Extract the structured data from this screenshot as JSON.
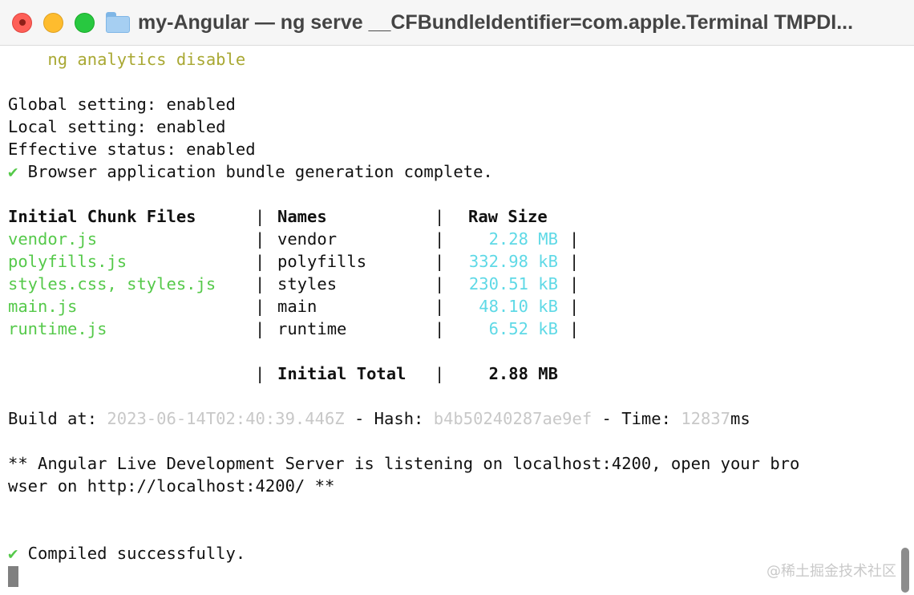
{
  "window": {
    "title": "my-Angular — ng serve __CFBundleIdentifier=com.apple.Terminal TMPDI..."
  },
  "terminal": {
    "analytics_cmd": "    ng analytics disable",
    "global_setting": "Global setting: enabled",
    "local_setting": "Local setting: enabled",
    "effective_status": "Effective status: enabled",
    "check_mark": "✔",
    "bundle_complete": " Browser application bundle generation complete.",
    "table": {
      "headers": {
        "files": "Initial Chunk Files",
        "names": "Names",
        "size": "Raw Size"
      },
      "sep": " | ",
      "rows": [
        {
          "file": "vendor.js",
          "name": "vendor",
          "size": "2.28 MB"
        },
        {
          "file": "polyfills.js",
          "name": "polyfills",
          "size": "332.98 kB"
        },
        {
          "file": "styles.css, styles.js",
          "name": "styles",
          "size": "230.51 kB"
        },
        {
          "file": "main.js",
          "name": "main",
          "size": "48.10 kB"
        },
        {
          "file": "runtime.js",
          "name": "runtime",
          "size": "6.52 kB"
        }
      ],
      "total_label": "Initial Total",
      "total_size": "2.88 MB"
    },
    "build": {
      "prefix": "Build at: ",
      "timestamp": "2023-06-14T02:40:39.446Z",
      "hash_label": " - Hash: ",
      "hash": "b4b50240287ae9ef",
      "time_label": " - Time: ",
      "time_value": "12837",
      "time_unit": "ms"
    },
    "server_line_1": "** Angular Live Development Server is listening on localhost:4200, open your bro",
    "server_line_2": "wser on http://localhost:4200/ **",
    "compiled": " Compiled successfully."
  },
  "watermark": "@稀土掘金技术社区"
}
